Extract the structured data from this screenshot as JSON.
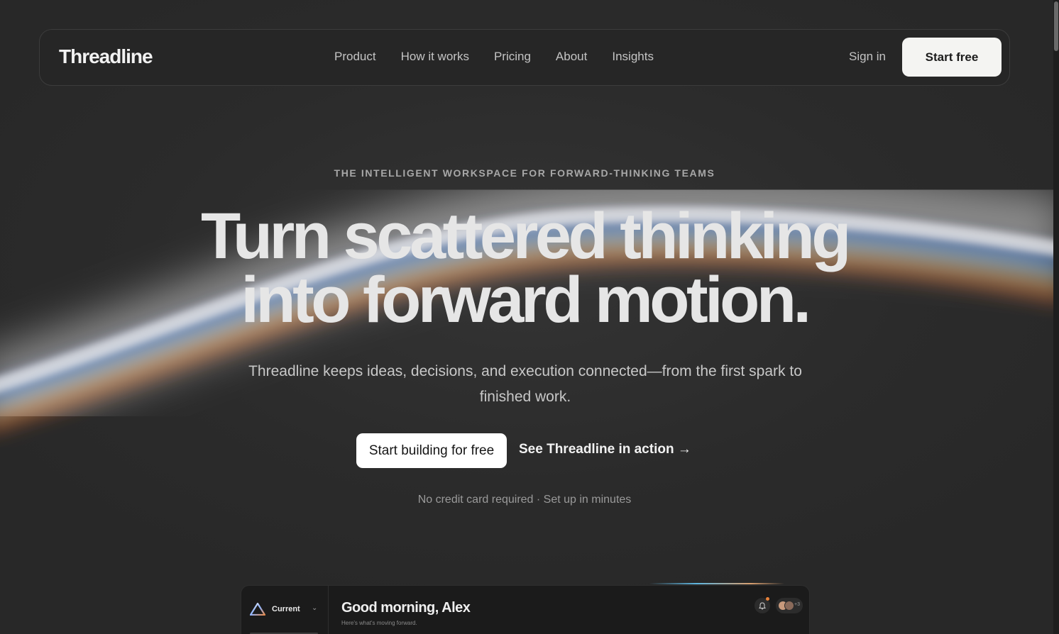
{
  "nav": {
    "logo": "Threadline",
    "links": [
      "Product",
      "How it works",
      "Pricing",
      "About",
      "Insights"
    ],
    "sign_in": "Sign in",
    "start_free": "Start free"
  },
  "hero": {
    "eyebrow": "THE INTELLIGENT WORKSPACE FOR FORWARD-THINKING TEAMS",
    "headline_line1": "Turn scattered thinking",
    "headline_line2": "into forward motion.",
    "subheadline": "Threadline keeps ideas, decisions, and execution connected—from the first spark to finished work.",
    "cta_primary": "Start building for free",
    "cta_secondary": "See Threadline in action →",
    "note": "No credit card required · Set up in minutes"
  },
  "preview": {
    "workspace": "Current",
    "greeting": "Good morning, Alex",
    "greeting_sub": "Here's what's moving forward.",
    "avatar_overflow": "+3",
    "icons": [
      "triangle-logo-icon",
      "chevron-down-icon",
      "bell-icon"
    ]
  },
  "colors": {
    "background": "#2a2a2a",
    "primary_button": "#f4f4f2",
    "accent_notification": "#e8823a"
  }
}
